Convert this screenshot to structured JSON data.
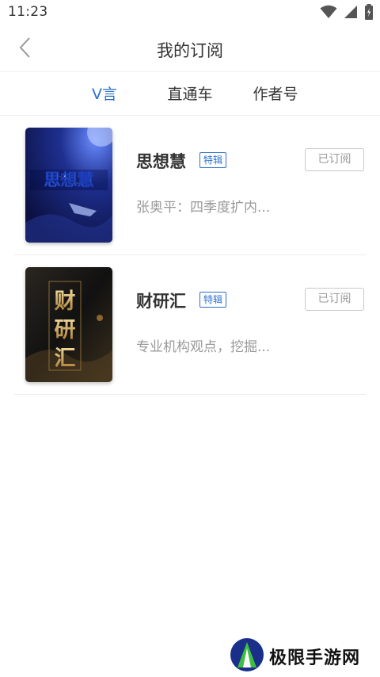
{
  "status_bar": {
    "time": "11:23"
  },
  "header": {
    "title": "我的订阅"
  },
  "tabs": [
    {
      "label": "V言",
      "active": true
    },
    {
      "label": "直通车",
      "active": false
    },
    {
      "label": "作者号",
      "active": false
    }
  ],
  "subscriptions": [
    {
      "cover_text": "思想慧",
      "title": "思想慧",
      "badge": "特辑",
      "button": "已订阅",
      "desc": "张奥平：四季度扩内..."
    },
    {
      "cover_text": "财研汇",
      "title": "财研汇",
      "badge": "特辑",
      "button": "已订阅",
      "desc": "专业机构观点，挖掘..."
    }
  ],
  "watermark": {
    "text": "极限手游网"
  },
  "colors": {
    "accent": "#2b6fc9",
    "muted": "#999999",
    "divider": "#ececec"
  }
}
